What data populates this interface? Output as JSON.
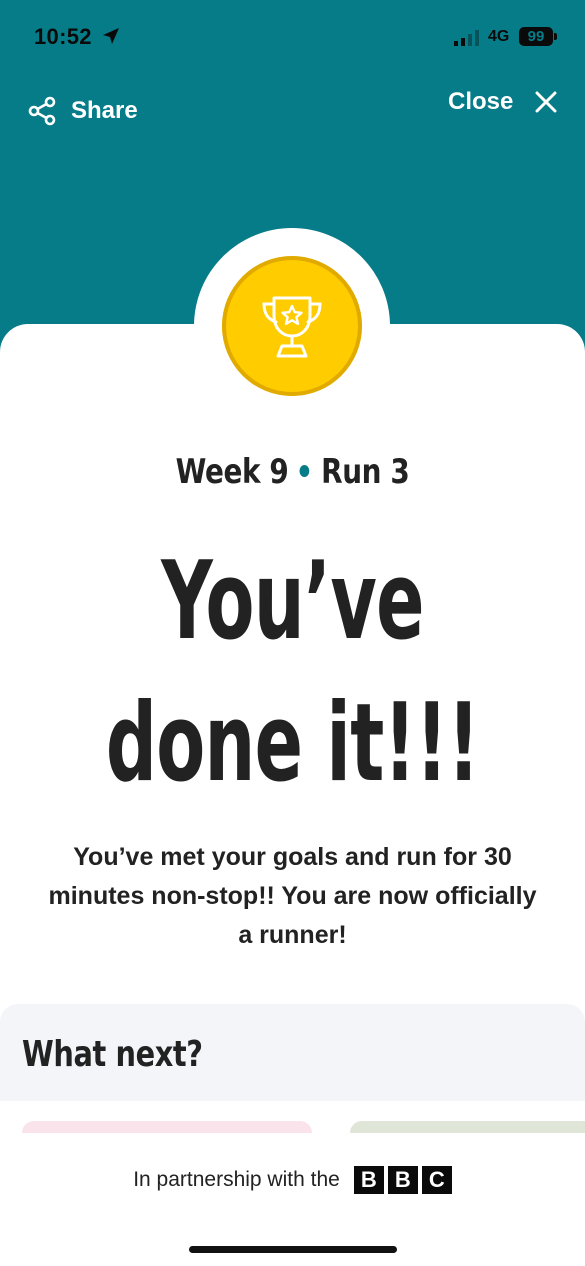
{
  "status_bar": {
    "time": "10:52",
    "network": "4G",
    "battery": "99"
  },
  "header": {
    "share_label": "Share",
    "close_label": "Close"
  },
  "colors": {
    "brand_teal": "#077c89",
    "badge_yellow": "#ffcc00",
    "text": "#222222"
  },
  "badge": {
    "icon": "trophy-star-icon"
  },
  "week_line": {
    "week": "Week 9",
    "run": "Run 3"
  },
  "headline": {
    "line1": "You’ve",
    "line2": "done it!!!"
  },
  "message": "You’ve met your goals and run for 30 minutes non-stop!! You are now officially a runner!",
  "what_next": {
    "title": "What next?"
  },
  "footer": {
    "partner_text": "In partnership with the",
    "logo_letters": [
      "B",
      "B",
      "C"
    ]
  }
}
